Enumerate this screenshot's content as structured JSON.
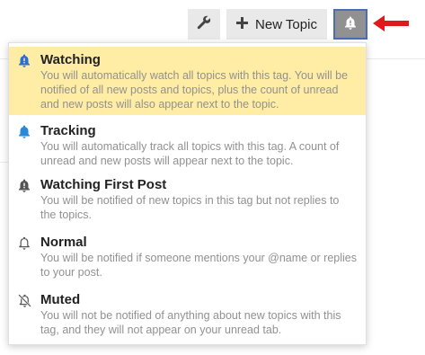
{
  "toolbar": {
    "new_topic_label": "New Topic",
    "wrench_icon": "wrench-icon",
    "plus_icon": "plus-icon",
    "notification_icon": "bell-exclamation-icon"
  },
  "annotation": {
    "arrow_color": "#e0191b"
  },
  "notification_menu": {
    "active_background": "#ffeda6",
    "items": [
      {
        "title": "Watching",
        "description": "You will automatically watch all topics with this tag. You will be notified of all new posts and topics, plus the count of unread and new posts will also appear next to the topic.",
        "icon": "bell-exclamation-icon",
        "icon_color": "#2a6fd6",
        "selected": true
      },
      {
        "title": "Tracking",
        "description": "You will automatically track all topics with this tag. A count of unread and new posts will appear next to the topic.",
        "icon": "bell-icon",
        "icon_color": "#2a8ad8",
        "selected": false
      },
      {
        "title": "Watching First Post",
        "description": "You will be notified of new topics in this tag but not replies to the topics.",
        "icon": "bell-exclamation-icon",
        "icon_color": "#555555",
        "selected": false
      },
      {
        "title": "Normal",
        "description": "You will be notified if someone mentions your @name or replies to your post.",
        "icon": "bell-outline-icon",
        "icon_color": "#555555",
        "selected": false
      },
      {
        "title": "Muted",
        "description": "You will not be notified of anything about new topics with this tag, and they will not appear on your unread tab.",
        "icon": "bell-slash-icon",
        "icon_color": "#555555",
        "selected": false
      }
    ]
  }
}
